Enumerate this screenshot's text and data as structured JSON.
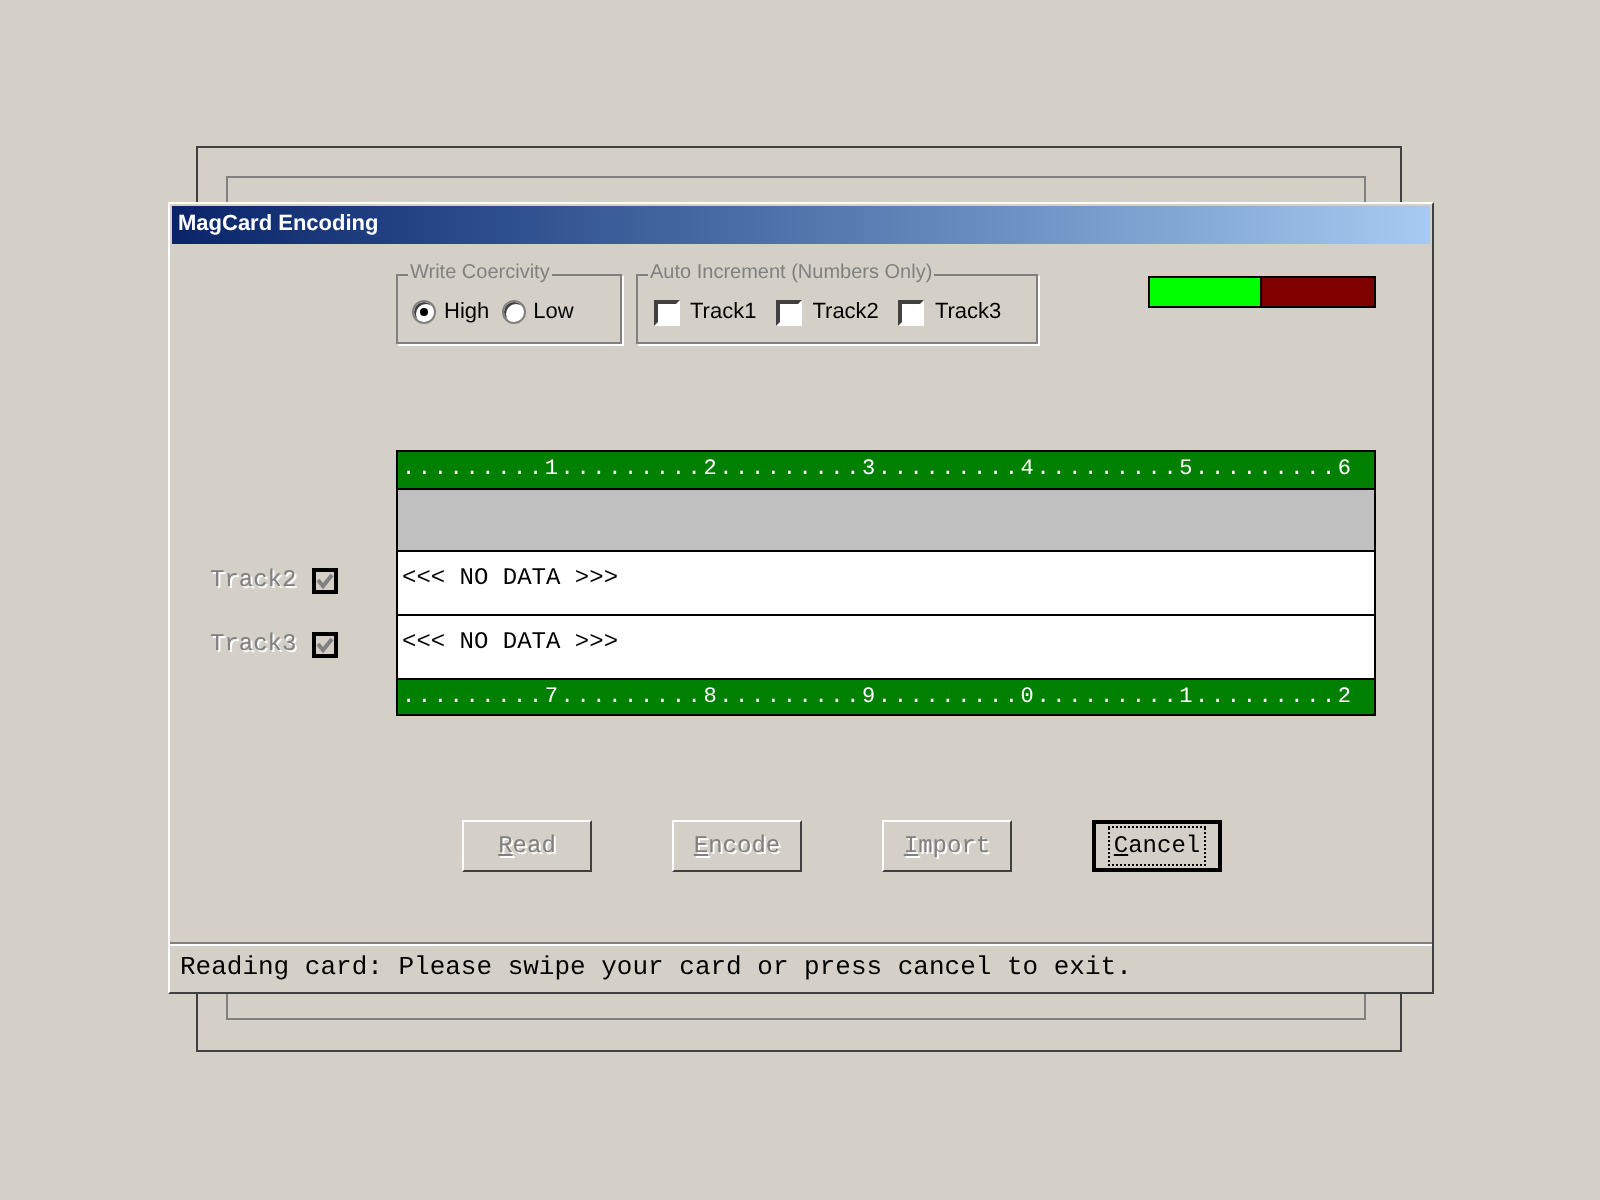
{
  "window": {
    "title": "MagCard Encoding"
  },
  "write_coercivity": {
    "label": "Write Coercivity",
    "options": [
      {
        "label": "High",
        "selected": true
      },
      {
        "label": "Low",
        "selected": false
      }
    ]
  },
  "auto_increment": {
    "label": "Auto Increment (Numbers Only)",
    "tracks": [
      {
        "label": "Track1",
        "checked": false
      },
      {
        "label": "Track2",
        "checked": false
      },
      {
        "label": "Track3",
        "checked": false
      }
    ]
  },
  "meter": {
    "level": 0.5
  },
  "track_options": [
    {
      "label": "Track2",
      "checked": true,
      "disabled": true
    },
    {
      "label": "Track3",
      "checked": true,
      "disabled": true
    }
  ],
  "ruler_top": ".........1.........2.........3.........4.........5.........6",
  "tracks": [
    {
      "kind": "empty"
    },
    {
      "text": "<<< NO DATA >>>",
      "kind": "data"
    },
    {
      "text": "<<< NO DATA >>>",
      "kind": "data"
    }
  ],
  "ruler_bottom": ".........7.........8.........9.........0.........1.........2",
  "buttons": [
    {
      "label": "Read",
      "disabled": true,
      "default": false
    },
    {
      "label": "Encode",
      "disabled": true,
      "default": false
    },
    {
      "label": "Import",
      "disabled": true,
      "default": false
    },
    {
      "label": "Cancel",
      "disabled": false,
      "default": true
    }
  ],
  "status_bar": "Reading card: Please swipe your card or press cancel to exit."
}
